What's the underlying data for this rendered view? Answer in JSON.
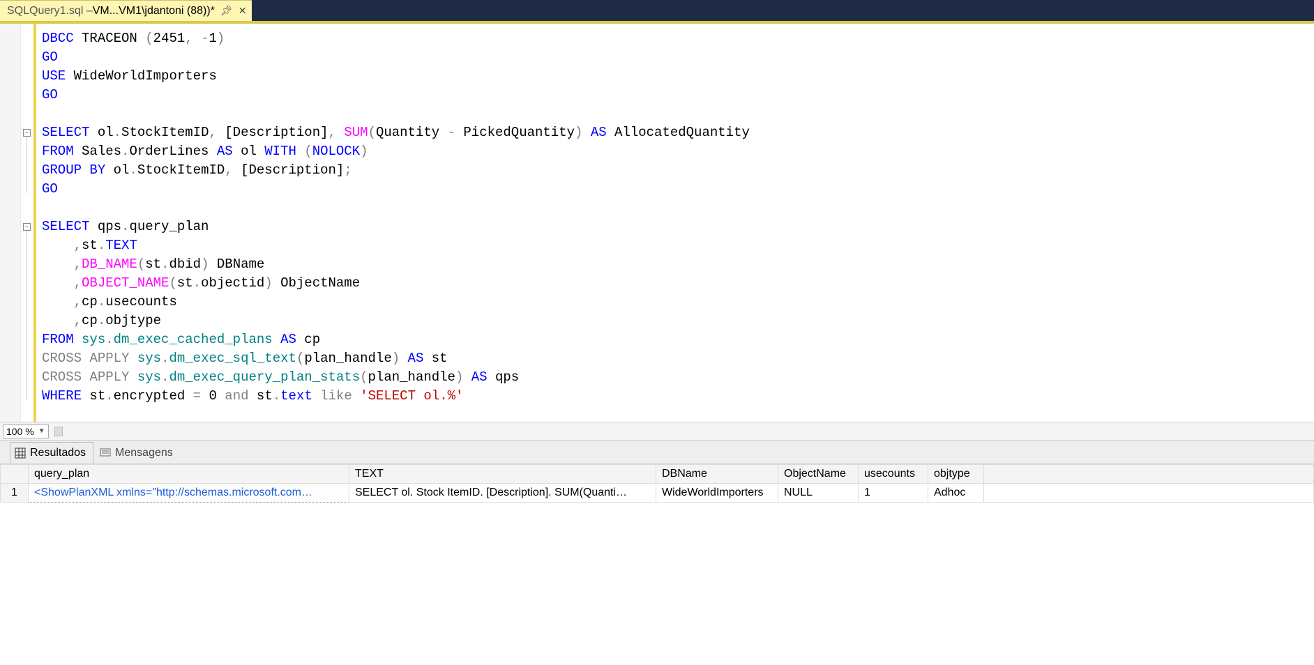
{
  "tab": {
    "title_part1": "SQLQuery1.sql –",
    "title_part2": "VM...VM1\\jdantoni (88))*"
  },
  "code_lines": [
    [
      {
        "t": "DBCC",
        "c": "kw-blue"
      },
      {
        "t": " TRACEON ",
        "c": "ident"
      },
      {
        "t": "(",
        "c": "paren"
      },
      {
        "t": "2451",
        "c": "num"
      },
      {
        "t": ",",
        "c": "paren"
      },
      {
        "t": " ",
        "c": ""
      },
      {
        "t": "-",
        "c": "paren"
      },
      {
        "t": "1",
        "c": "num"
      },
      {
        "t": ")",
        "c": "paren"
      }
    ],
    [
      {
        "t": "GO",
        "c": "kw-blue"
      }
    ],
    [
      {
        "t": "USE",
        "c": "kw-blue"
      },
      {
        "t": " WideWorldImporters",
        "c": "ident"
      }
    ],
    [
      {
        "t": "GO",
        "c": "kw-blue"
      }
    ],
    [
      {
        "t": "",
        "c": ""
      }
    ],
    [
      {
        "t": "SELECT",
        "c": "kw-blue"
      },
      {
        "t": " ol",
        "c": "ident"
      },
      {
        "t": ".",
        "c": "paren"
      },
      {
        "t": "StockItemID",
        "c": "ident"
      },
      {
        "t": ",",
        "c": "paren"
      },
      {
        "t": " [Description]",
        "c": "ident"
      },
      {
        "t": ",",
        "c": "paren"
      },
      {
        "t": " ",
        "c": ""
      },
      {
        "t": "SUM",
        "c": "kw-pink"
      },
      {
        "t": "(",
        "c": "paren"
      },
      {
        "t": "Quantity ",
        "c": "ident"
      },
      {
        "t": "-",
        "c": "paren"
      },
      {
        "t": " PickedQuantity",
        "c": "ident"
      },
      {
        "t": ")",
        "c": "paren"
      },
      {
        "t": " ",
        "c": ""
      },
      {
        "t": "AS",
        "c": "kw-blue"
      },
      {
        "t": " AllocatedQuantity",
        "c": "ident"
      }
    ],
    [
      {
        "t": "FROM",
        "c": "kw-blue"
      },
      {
        "t": " Sales",
        "c": "ident"
      },
      {
        "t": ".",
        "c": "paren"
      },
      {
        "t": "OrderLines ",
        "c": "ident"
      },
      {
        "t": "AS",
        "c": "kw-blue"
      },
      {
        "t": " ol ",
        "c": "ident"
      },
      {
        "t": "WITH",
        "c": "kw-blue"
      },
      {
        "t": " ",
        "c": ""
      },
      {
        "t": "(",
        "c": "paren"
      },
      {
        "t": "NOLOCK",
        "c": "kw-blue"
      },
      {
        "t": ")",
        "c": "paren"
      }
    ],
    [
      {
        "t": "GROUP",
        "c": "kw-blue"
      },
      {
        "t": " ",
        "c": ""
      },
      {
        "t": "BY",
        "c": "kw-blue"
      },
      {
        "t": " ol",
        "c": "ident"
      },
      {
        "t": ".",
        "c": "paren"
      },
      {
        "t": "StockItemID",
        "c": "ident"
      },
      {
        "t": ",",
        "c": "paren"
      },
      {
        "t": " [Description]",
        "c": "ident"
      },
      {
        "t": ";",
        "c": "paren"
      }
    ],
    [
      {
        "t": "GO",
        "c": "kw-blue"
      }
    ],
    [
      {
        "t": "",
        "c": ""
      }
    ],
    [
      {
        "t": "SELECT",
        "c": "kw-blue"
      },
      {
        "t": " qps",
        "c": "ident"
      },
      {
        "t": ".",
        "c": "paren"
      },
      {
        "t": "query_plan",
        "c": "ident"
      }
    ],
    [
      {
        "t": "    ",
        "c": ""
      },
      {
        "t": ",",
        "c": "paren"
      },
      {
        "t": "st",
        "c": "ident"
      },
      {
        "t": ".",
        "c": "paren"
      },
      {
        "t": "TEXT",
        "c": "kw-blue"
      }
    ],
    [
      {
        "t": "    ",
        "c": ""
      },
      {
        "t": ",",
        "c": "paren"
      },
      {
        "t": "DB_NAME",
        "c": "kw-pink"
      },
      {
        "t": "(",
        "c": "paren"
      },
      {
        "t": "st",
        "c": "ident"
      },
      {
        "t": ".",
        "c": "paren"
      },
      {
        "t": "dbid",
        "c": "ident"
      },
      {
        "t": ")",
        "c": "paren"
      },
      {
        "t": " DBName",
        "c": "ident"
      }
    ],
    [
      {
        "t": "    ",
        "c": ""
      },
      {
        "t": ",",
        "c": "paren"
      },
      {
        "t": "OBJECT_NAME",
        "c": "kw-pink"
      },
      {
        "t": "(",
        "c": "paren"
      },
      {
        "t": "st",
        "c": "ident"
      },
      {
        "t": ".",
        "c": "paren"
      },
      {
        "t": "objectid",
        "c": "ident"
      },
      {
        "t": ")",
        "c": "paren"
      },
      {
        "t": " ObjectName",
        "c": "ident"
      }
    ],
    [
      {
        "t": "    ",
        "c": ""
      },
      {
        "t": ",",
        "c": "paren"
      },
      {
        "t": "cp",
        "c": "ident"
      },
      {
        "t": ".",
        "c": "paren"
      },
      {
        "t": "usecounts",
        "c": "ident"
      }
    ],
    [
      {
        "t": "    ",
        "c": ""
      },
      {
        "t": ",",
        "c": "paren"
      },
      {
        "t": "cp",
        "c": "ident"
      },
      {
        "t": ".",
        "c": "paren"
      },
      {
        "t": "objtype",
        "c": "ident"
      }
    ],
    [
      {
        "t": "FROM",
        "c": "kw-blue"
      },
      {
        "t": " ",
        "c": ""
      },
      {
        "t": "sys",
        "c": "teal-id"
      },
      {
        "t": ".",
        "c": "paren"
      },
      {
        "t": "dm_exec_cached_plans",
        "c": "teal-id"
      },
      {
        "t": " ",
        "c": ""
      },
      {
        "t": "AS",
        "c": "kw-blue"
      },
      {
        "t": " cp",
        "c": "ident"
      }
    ],
    [
      {
        "t": "CROSS",
        "c": "kw-gray"
      },
      {
        "t": " ",
        "c": ""
      },
      {
        "t": "APPLY",
        "c": "kw-gray"
      },
      {
        "t": " ",
        "c": ""
      },
      {
        "t": "sys",
        "c": "teal-id"
      },
      {
        "t": ".",
        "c": "paren"
      },
      {
        "t": "dm_exec_sql_text",
        "c": "teal-id"
      },
      {
        "t": "(",
        "c": "paren"
      },
      {
        "t": "plan_handle",
        "c": "ident"
      },
      {
        "t": ")",
        "c": "paren"
      },
      {
        "t": " ",
        "c": ""
      },
      {
        "t": "AS",
        "c": "kw-blue"
      },
      {
        "t": " st",
        "c": "ident"
      }
    ],
    [
      {
        "t": "CROSS",
        "c": "kw-gray"
      },
      {
        "t": " ",
        "c": ""
      },
      {
        "t": "APPLY",
        "c": "kw-gray"
      },
      {
        "t": " ",
        "c": ""
      },
      {
        "t": "sys",
        "c": "teal-id"
      },
      {
        "t": ".",
        "c": "paren"
      },
      {
        "t": "dm_exec_query_plan_stats",
        "c": "teal-id"
      },
      {
        "t": "(",
        "c": "paren"
      },
      {
        "t": "plan_handle",
        "c": "ident"
      },
      {
        "t": ")",
        "c": "paren"
      },
      {
        "t": " ",
        "c": ""
      },
      {
        "t": "AS",
        "c": "kw-blue"
      },
      {
        "t": " qps",
        "c": "ident"
      }
    ],
    [
      {
        "t": "WHERE",
        "c": "kw-blue"
      },
      {
        "t": " st",
        "c": "ident"
      },
      {
        "t": ".",
        "c": "paren"
      },
      {
        "t": "encrypted ",
        "c": "ident"
      },
      {
        "t": "=",
        "c": "paren"
      },
      {
        "t": " 0 ",
        "c": "num"
      },
      {
        "t": "and",
        "c": "kw-gray"
      },
      {
        "t": " st",
        "c": "ident"
      },
      {
        "t": ".",
        "c": "paren"
      },
      {
        "t": "text",
        "c": "kw-blue"
      },
      {
        "t": " ",
        "c": ""
      },
      {
        "t": "like",
        "c": "kw-gray"
      },
      {
        "t": " ",
        "c": ""
      },
      {
        "t": "'SELECT ol.%'",
        "c": "kw-red"
      }
    ]
  ],
  "fold_markers": [
    {
      "line_index": 5
    },
    {
      "line_index": 10
    }
  ],
  "current_line_index": 3,
  "zoom": {
    "value": "100 %"
  },
  "result_tabs": {
    "results_label": "Resultados",
    "messages_label": "Mensagens"
  },
  "grid": {
    "headers": [
      "query_plan",
      "TEXT",
      "DBName",
      "ObjectName",
      "usecounts",
      "objtype"
    ],
    "rows": [
      {
        "n": "1",
        "cells": [
          "<ShowPlanXML xmlns=\"http://schemas.microsoft.com…",
          "SELECT ol. Stock ItemID. [Description]. SUM(Quanti…",
          "WideWorldImporters",
          "NULL",
          "1",
          "Adhoc"
        ]
      }
    ]
  }
}
